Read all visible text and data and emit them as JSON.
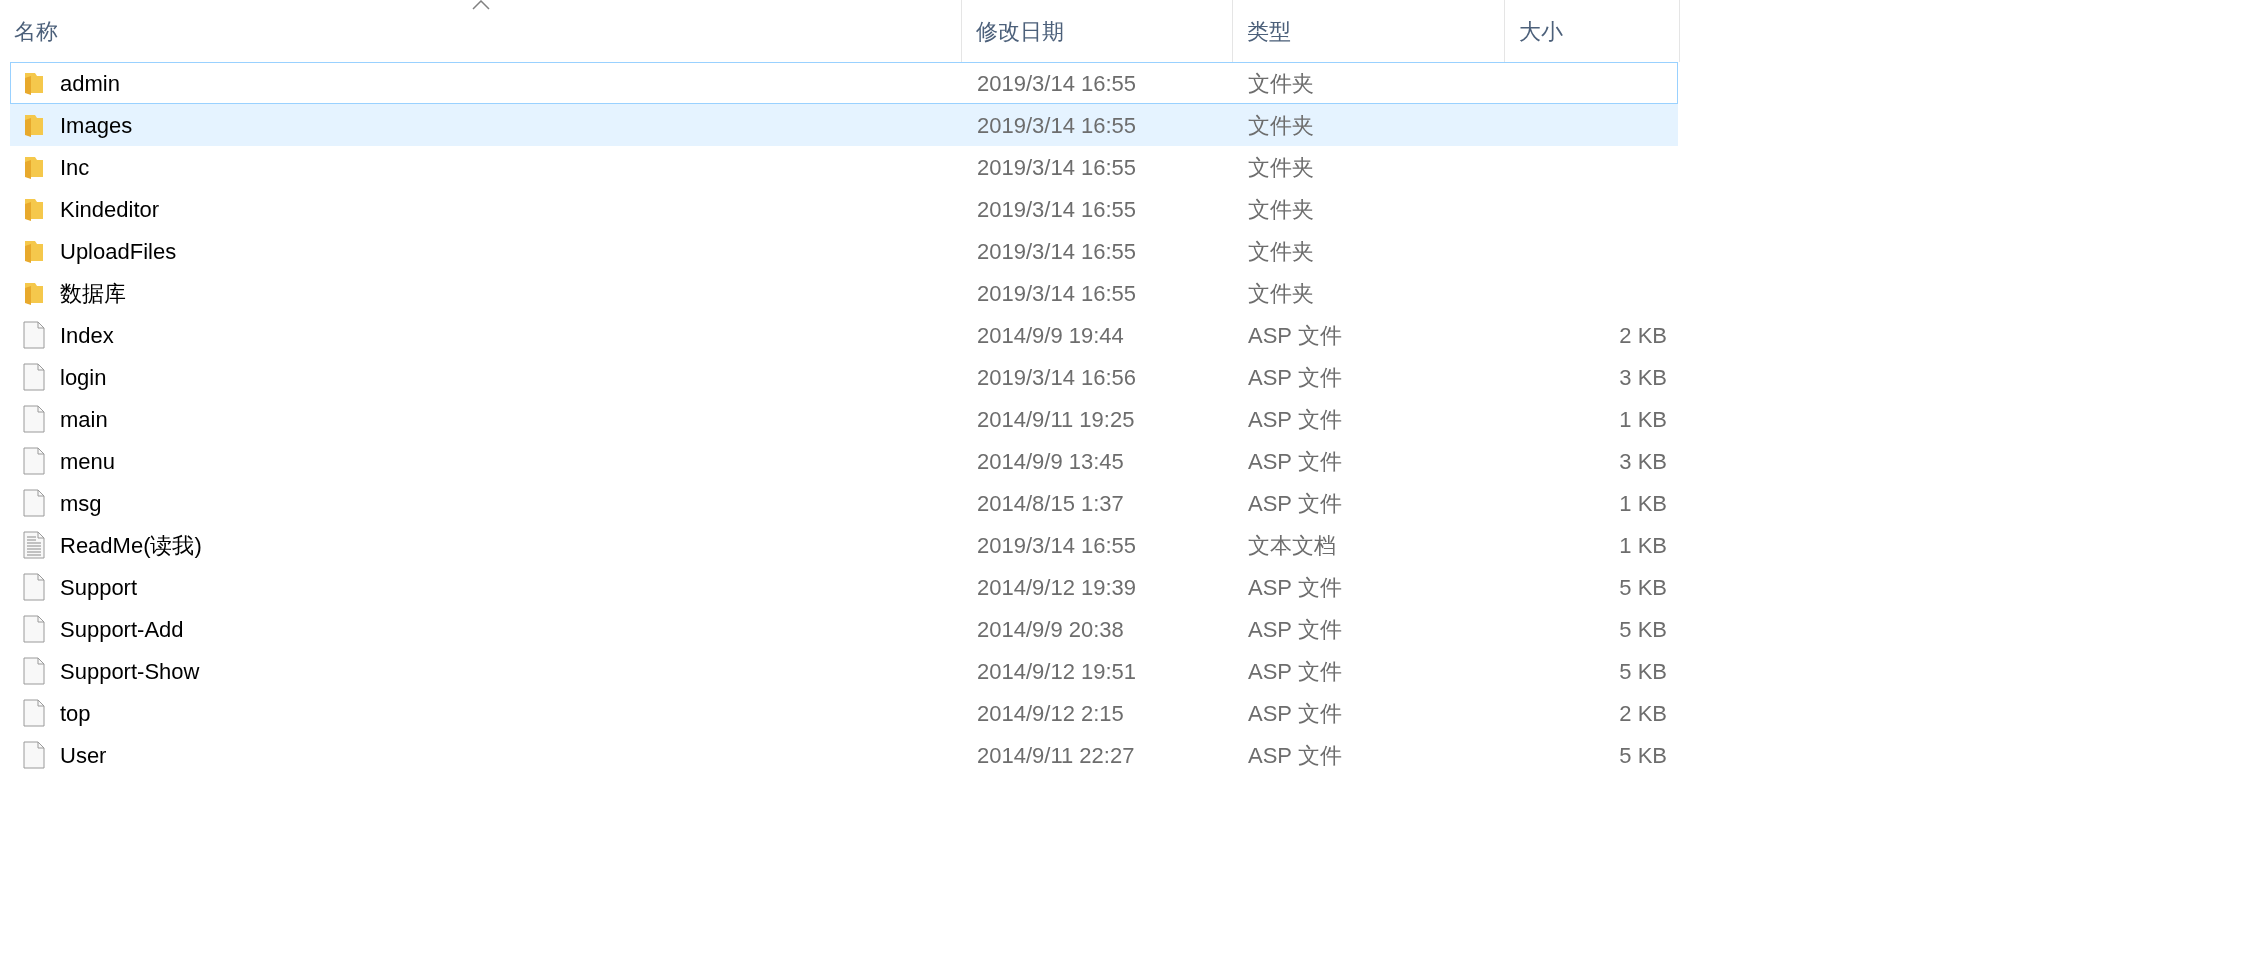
{
  "columns": [
    {
      "label": "名称",
      "sorted": true
    },
    {
      "label": "修改日期",
      "sorted": false
    },
    {
      "label": "类型",
      "sorted": false
    },
    {
      "label": "大小",
      "sorted": false
    }
  ],
  "rows": [
    {
      "kind": "folder",
      "name": "admin",
      "date": "2019/3/14 16:55",
      "type": "文件夹",
      "selected": false,
      "focused": true
    },
    {
      "kind": "folder",
      "name": "Images",
      "date": "2019/3/14 16:55",
      "type": "文件夹",
      "selected": true,
      "focused": false
    },
    {
      "kind": "folder",
      "name": "Inc",
      "date": "2019/3/14 16:55",
      "type": "文件夹",
      "selected": false,
      "focused": false
    },
    {
      "kind": "folder",
      "name": "Kindeditor",
      "date": "2019/3/14 16:55",
      "type": "文件夹",
      "selected": false,
      "focused": false
    },
    {
      "kind": "folder",
      "name": "UploadFiles",
      "date": "2019/3/14 16:55",
      "type": "文件夹",
      "selected": false,
      "focused": false
    },
    {
      "kind": "folder",
      "name": "数据库",
      "date": "2019/3/14 16:55",
      "type": "文件夹",
      "selected": false,
      "focused": false
    },
    {
      "kind": "file",
      "name": "Index",
      "date": "2014/9/9 19:44",
      "type": "ASP 文件",
      "size": "2 KB",
      "selected": false,
      "focused": false
    },
    {
      "kind": "file",
      "name": "login",
      "date": "2019/3/14 16:56",
      "type": "ASP 文件",
      "size": "3 KB",
      "selected": false,
      "focused": false
    },
    {
      "kind": "file",
      "name": "main",
      "date": "2014/9/11 19:25",
      "type": "ASP 文件",
      "size": "1 KB",
      "selected": false,
      "focused": false
    },
    {
      "kind": "file",
      "name": "menu",
      "date": "2014/9/9 13:45",
      "type": "ASP 文件",
      "size": "3 KB",
      "selected": false,
      "focused": false
    },
    {
      "kind": "file",
      "name": "msg",
      "date": "2014/8/15 1:37",
      "type": "ASP 文件",
      "size": "1 KB",
      "selected": false,
      "focused": false
    },
    {
      "kind": "text",
      "name": "ReadMe(读我)",
      "date": "2019/3/14 16:55",
      "type": "文本文档",
      "size": "1 KB",
      "selected": false,
      "focused": false
    },
    {
      "kind": "file",
      "name": "Support",
      "date": "2014/9/12 19:39",
      "type": "ASP 文件",
      "size": "5 KB",
      "selected": false,
      "focused": false
    },
    {
      "kind": "file",
      "name": "Support-Add",
      "date": "2014/9/9 20:38",
      "type": "ASP 文件",
      "size": "5 KB",
      "selected": false,
      "focused": false
    },
    {
      "kind": "file",
      "name": "Support-Show",
      "date": "2014/9/12 19:51",
      "type": "ASP 文件",
      "size": "5 KB",
      "selected": false,
      "focused": false
    },
    {
      "kind": "file",
      "name": "top",
      "date": "2014/9/12 2:15",
      "type": "ASP 文件",
      "size": "2 KB",
      "selected": false,
      "focused": false
    },
    {
      "kind": "file",
      "name": "User",
      "date": "2014/9/11 22:27",
      "type": "ASP 文件",
      "size": "5 KB",
      "selected": false,
      "focused": false
    }
  ]
}
